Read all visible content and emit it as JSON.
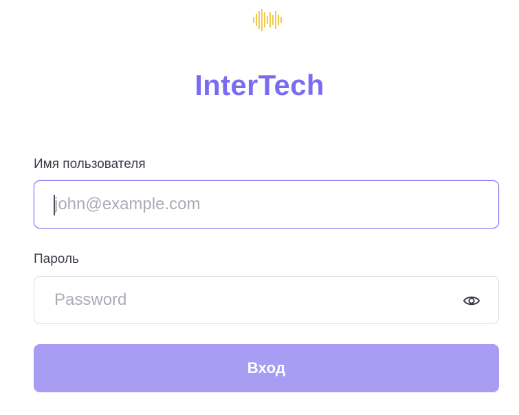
{
  "brand": {
    "name": "InterTech",
    "logo_icon": "sound-wave-icon",
    "logo_color": "#f2c94c",
    "accent_color": "#7a6cf0"
  },
  "form": {
    "username": {
      "label": "Имя пользователя",
      "value": "",
      "placeholder": "john@example.com",
      "focused": true
    },
    "password": {
      "label": "Пароль",
      "value": "",
      "placeholder": "Password",
      "toggle_icon": "eye-icon"
    },
    "submit": {
      "label": "Вход",
      "color": "#a89df3"
    }
  }
}
